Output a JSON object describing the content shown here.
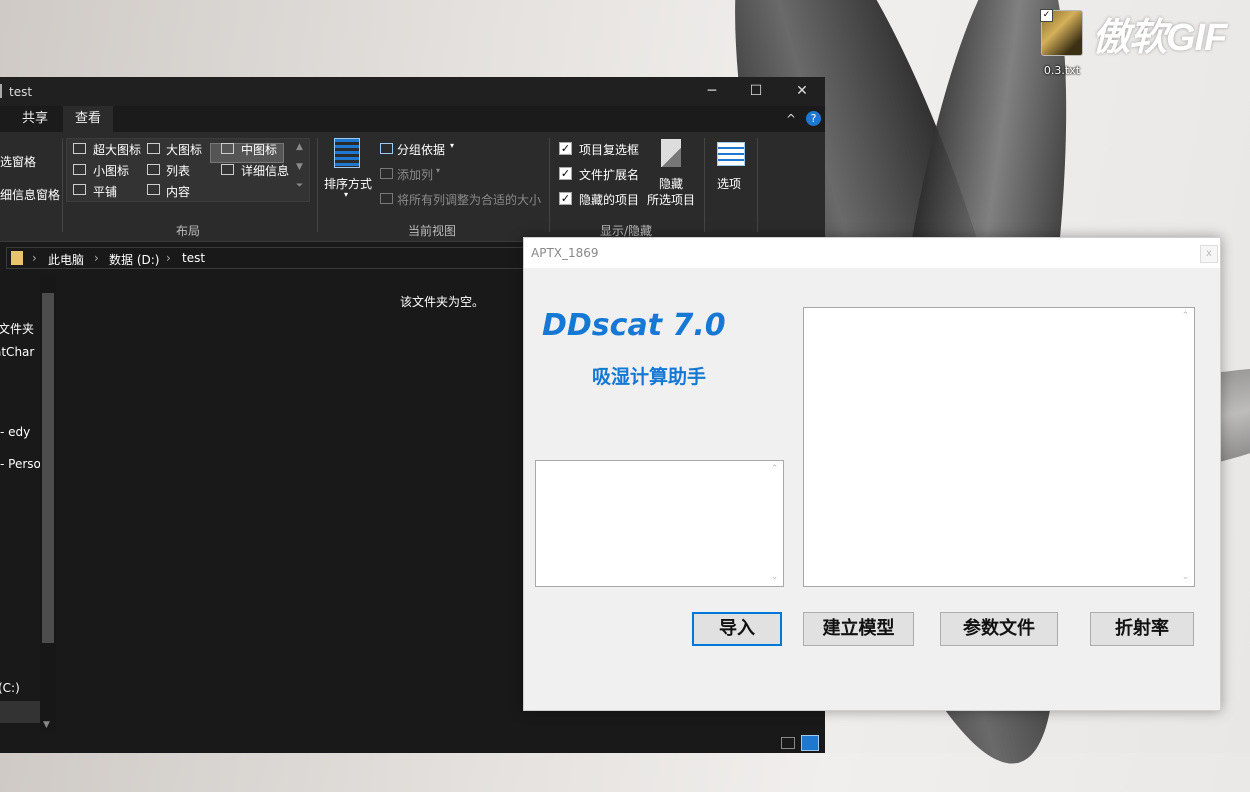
{
  "desktop": {
    "file_label": "0.3.txt",
    "watermark": "傲软GIF"
  },
  "explorer": {
    "title": "test",
    "window_buttons": [
      "─",
      "☐",
      "✕"
    ],
    "tabs": [
      "共享",
      "查看"
    ],
    "help_icons": [
      "^",
      "?"
    ],
    "ribbon": {
      "pane_items": [
        "选窗格",
        "细信息窗格"
      ],
      "layout_items": [
        "超大图标",
        "大图标",
        "中图标",
        "小图标",
        "列表",
        "详细信息",
        "平铺",
        "内容"
      ],
      "layout_group": "布局",
      "sort_label": "排序方式",
      "group_by": "分组依据",
      "add_column": "添加列",
      "fit_columns": "将所有列调整为合适的大小",
      "current_view_group": "当前视图",
      "checkboxes": [
        "项目复选框",
        "文件扩展名",
        "隐藏的项目"
      ],
      "hide_selected_1": "隐藏",
      "hide_selected_2": "所选项目",
      "show_hide_group": "显示/隐藏",
      "options": "选项"
    },
    "breadcrumb": [
      "此电脑",
      "数据 (D:)",
      "test"
    ],
    "nav_items": [
      "文件夹",
      "atChar",
      "- edy",
      "- Perso",
      "(C:)"
    ],
    "empty_message": "该文件夹为空。"
  },
  "dialog": {
    "window_title": "APTX_1869",
    "close_glyph": "x",
    "app_title": "DDscat 7.0",
    "app_subtitle": "吸湿计算助手",
    "buttons": {
      "import": "导入",
      "build_model": "建立模型",
      "param_file": "参数文件",
      "refractive_index": "折射率"
    },
    "accent_color": "#1478d4"
  }
}
